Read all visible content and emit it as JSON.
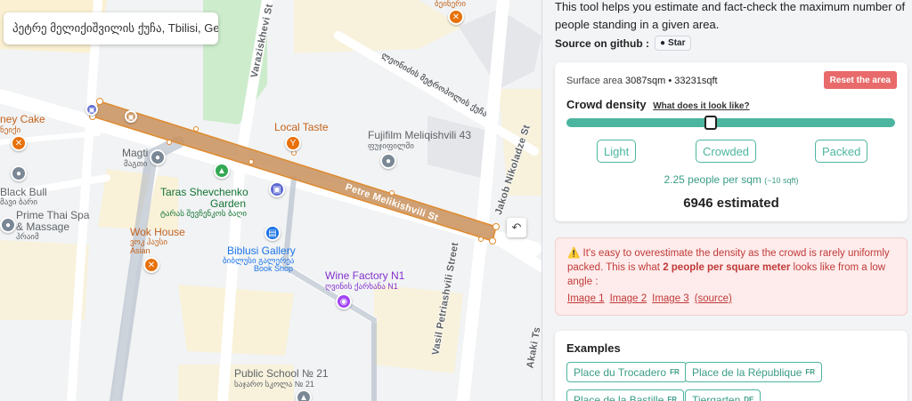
{
  "map": {
    "search_text": "პეტრე მელიქიშვილის ქუჩა, Tbilisi, Ge...",
    "streets": {
      "varazis": "Varazis​khevi St",
      "petre": "Petre Melikishvili St",
      "vasil": "Vasil Petriashvili Street",
      "jakob": "Jakob Nikoladze St",
      "akaki": "Akaki Ts",
      "georgian_top": "ლეონიძის მეტროპოლის ქუჩა"
    },
    "places": {
      "honey_cake": "ney Cake",
      "honey_cake_ka": "ნეიქი",
      "local_taste": "Local Taste",
      "fujifilm": "Fujifilm Meliqishvili 43",
      "fujifilm_ka": "ფუჯიფილმი",
      "magti": "Magti",
      "magti_ka": "მაგთი",
      "taras": "Taras Shevchenko",
      "taras2": "Garden",
      "taras_ka": "ტარას შევჩენკოს ბაღი",
      "black_bull": "Black Bull",
      "black_bull_ka": "მავი ბარი",
      "prime_thai": "Prime Thai Spa",
      "prime_thai2": "& Massage",
      "prime_thai_ka": "პრაიმ",
      "wok_house": "Wok House",
      "wok_house_ka": "ვოკ ჰაუსი",
      "wok_house_sub": "Asian",
      "biblusi": "Biblusi Gallery",
      "biblusi_ka": "ბიბლუსი გალერეა",
      "biblusi_sub": "Book Shop",
      "wine_factory": "Wine Factory N1",
      "wine_factory_ka": "ღვინის ქარხანა N1",
      "public_school": "Public School № 21",
      "public_school_ka": "საჯარო სკოლა № 21",
      "top_place_ka": "ბეინერი"
    },
    "undo_icon": "undo-icon"
  },
  "panel": {
    "intro": "This tool helps you estimate and fact-check the maximum number of people standing in a given area.",
    "github_label": "Source on github :",
    "star_label": "Star",
    "surface_label": "Surface area",
    "surface_value": "3087sqm • 33231sqft",
    "reset_label": "Reset the area",
    "density_label": "Crowd density",
    "density_link": "What does it look like?",
    "slider_fraction": 0.44,
    "presets": [
      "Light",
      "Crowded",
      "Packed"
    ],
    "ppl_value": "2.25 people per sqm",
    "ppl_sqft": "(~10 sqft)",
    "estimate": "6946 estimated",
    "warning_before": "It's easy to overestimate the density as the crowd is rarely uniformly packed. This is what ",
    "warning_bold": "2 people per square meter",
    "warning_after": " looks like from a low angle :",
    "warning_links": [
      "Image 1",
      "Image 2",
      "Image 3"
    ],
    "warning_source": "(source)",
    "examples_title": "Examples",
    "examples": [
      {
        "label": "Place du Trocadero",
        "tag": "FR"
      },
      {
        "label": "Place de la République",
        "tag": "FR"
      },
      {
        "label": "Place de la Bastille",
        "tag": "FR"
      },
      {
        "label": "Tiergarten",
        "tag": "DE"
      }
    ],
    "colors": {
      "accent": "#4cb59f",
      "reset": "#e86a6a",
      "warning": "#c13a3a"
    }
  }
}
